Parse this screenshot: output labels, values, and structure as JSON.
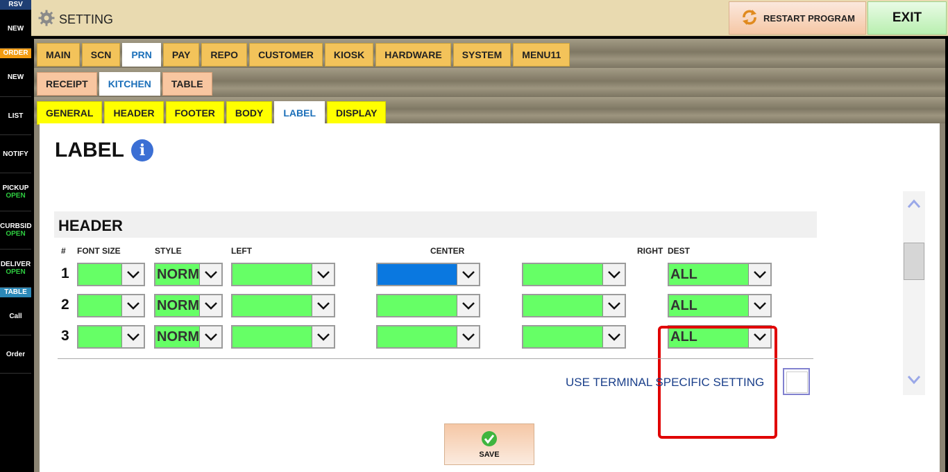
{
  "sidebar": {
    "rsv_label": "RSV",
    "rsv_new": "NEW",
    "order_label": "ORDER",
    "order_new": "NEW",
    "list": "LIST",
    "notify": "NOTIFY",
    "pickup": "PICKUP",
    "pickup_status": "OPEN",
    "curbside": "CURBSID",
    "curbside_status": "OPEN",
    "delivery": "DELIVER",
    "delivery_status": "OPEN",
    "table_label": "TABLE",
    "call": "Call",
    "order": "Order"
  },
  "topbar": {
    "title": "SETTING",
    "restart_label": "RESTART PROGRAM",
    "exit_label": "EXIT"
  },
  "tabs_main": [
    "MAIN",
    "SCN",
    "PRN",
    "PAY",
    "REPO",
    "CUSTOMER",
    "KIOSK",
    "HARDWARE",
    "SYSTEM",
    "MENU11"
  ],
  "tabs_main_active": "PRN",
  "tabs_sub": [
    "RECEIPT",
    "KITCHEN",
    "TABLE"
  ],
  "tabs_sub_active": "KITCHEN",
  "tabs_third": [
    "GENERAL",
    "HEADER",
    "FOOTER",
    "BODY",
    "LABEL",
    "DISPLAY"
  ],
  "tabs_third_active": "LABEL",
  "page_title": "LABEL",
  "section": {
    "title": "HEADER",
    "columns": {
      "num": "#",
      "font_size": "FONT SIZE",
      "style": "STYLE",
      "left": "LEFT",
      "center": "CENTER",
      "right": "RIGHT",
      "dest": "DEST"
    },
    "rows": [
      {
        "num": "1",
        "font_size": "",
        "style": "NORMAL",
        "left": "",
        "center": "",
        "right": "",
        "dest": "ALL"
      },
      {
        "num": "2",
        "font_size": "",
        "style": "NORMAL",
        "left": "",
        "center": "",
        "right": "",
        "dest": "ALL"
      },
      {
        "num": "3",
        "font_size": "",
        "style": "NORMAL",
        "left": "",
        "center": "",
        "right": "",
        "dest": "ALL"
      }
    ]
  },
  "terminal_setting_label": "USE TERMINAL SPECIFIC SETTING",
  "save_label": "SAVE",
  "colors": {
    "combo_green": "#66ff66",
    "combo_selected": "#0a78e0",
    "highlight_red": "#e00000",
    "active_tab_text": "#1b6fb9"
  }
}
